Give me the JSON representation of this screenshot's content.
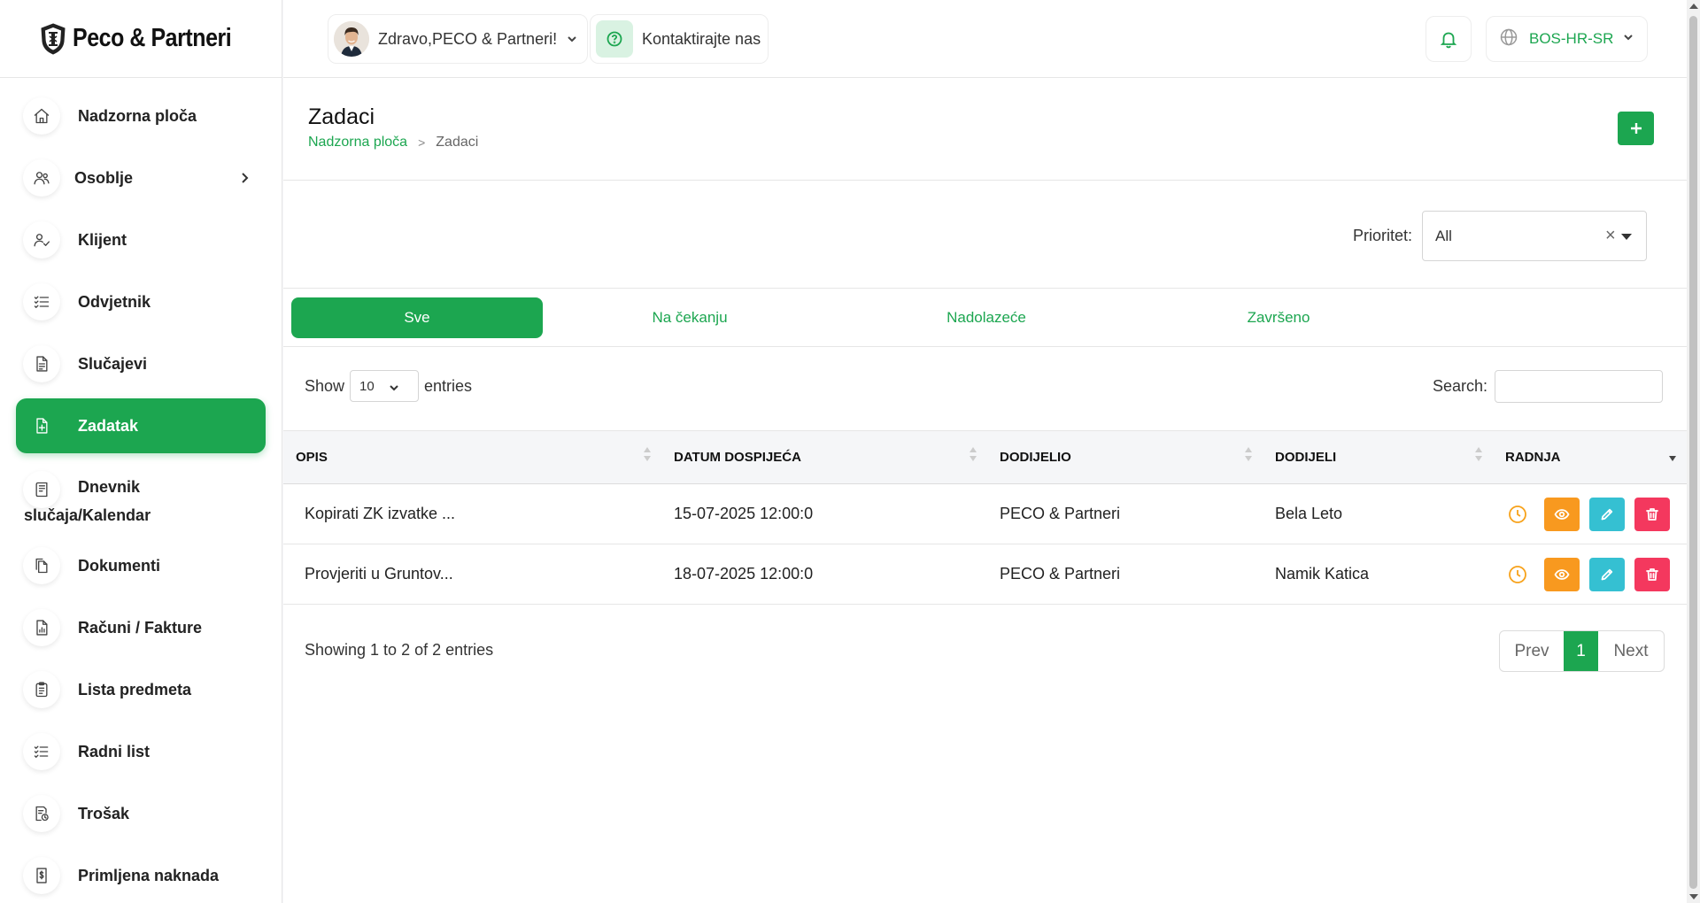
{
  "brand": {
    "name": "Peco & Partneri"
  },
  "colors": {
    "accent": "#1ca650",
    "view": "#f8991f",
    "edit": "#35c0d2",
    "delete": "#f4385e",
    "clock": "#f7a21b"
  },
  "header": {
    "greeting": "Zdravo,PECO & Partneri!",
    "contact": "Kontaktirajte nas",
    "language": "BOS-HR-SR",
    "icons": [
      "user-avatar",
      "question-icon",
      "bell-icon",
      "globe-icon"
    ]
  },
  "sidebar": {
    "items": [
      {
        "label": "Nadzorna ploča",
        "icon": "home-icon"
      },
      {
        "label": "Osoblje",
        "icon": "users-icon"
      },
      {
        "label": "Klijent",
        "icon": "user-check-icon"
      },
      {
        "label": "Odvjetnik",
        "icon": "list-check-icon"
      },
      {
        "label": "Slučajevi",
        "icon": "file-icon"
      },
      {
        "label": "Zadatak",
        "icon": "file-plus-icon"
      },
      {
        "label": "Dnevnik",
        "label2": "slučaja/Kalendar",
        "icon": "notebook-icon"
      },
      {
        "label": "Dokumenti",
        "icon": "copy-icon"
      },
      {
        "label": "Računi / Fakture",
        "icon": "invoice-icon"
      },
      {
        "label": "Lista predmeta",
        "icon": "clipboard-icon"
      },
      {
        "label": "Radni list",
        "icon": "list-icon"
      },
      {
        "label": "Trošak",
        "icon": "expense-icon"
      },
      {
        "label": "Primljena naknada",
        "icon": "dollar-file-icon"
      }
    ]
  },
  "page": {
    "title": "Zadaci",
    "breadcrumb": {
      "home": "Nadzorna ploča",
      "separator": ">",
      "current": "Zadaci"
    },
    "add_icon": "plus-icon"
  },
  "filter": {
    "label": "Prioritet:",
    "value": "All",
    "clear": "×"
  },
  "tabs": [
    "Sve",
    "Na čekanju",
    "Nadolazeće",
    "Završeno"
  ],
  "table": {
    "length": {
      "show": "Show",
      "value": "10",
      "entries": "entries"
    },
    "search_label": "Search:",
    "search_value": "",
    "columns": [
      "OPIS",
      "DATUM DOSPIJEĆA",
      "DODIJELIO",
      "DODIJELI",
      "RADNJA"
    ],
    "rows": [
      {
        "opis": "Kopirati ZK izvatke ...",
        "datum": "15-07-2025 12:00:0",
        "dodijelio": "PECO & Partneri",
        "dodijeli": "Bela Leto"
      },
      {
        "opis": "Provjeriti u Gruntov...",
        "datum": "18-07-2025 12:00:0",
        "dodijelio": "PECO & Partneri",
        "dodijeli": "Namik Katica"
      }
    ],
    "info": "Showing 1 to 2 of 2 entries",
    "pager": {
      "prev": "Prev",
      "page": "1",
      "next": "Next"
    }
  }
}
